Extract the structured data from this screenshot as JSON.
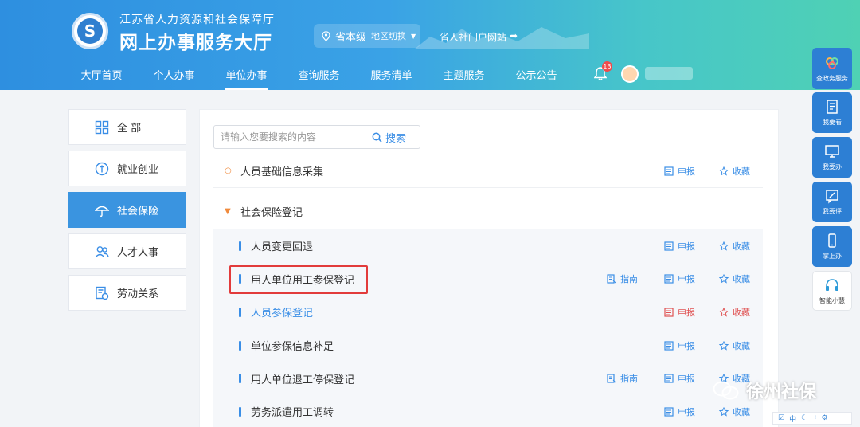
{
  "header": {
    "org_name": "江苏省人力资源和社会保障厅",
    "site_name": "网上办事服务大厅",
    "region_level": "省本级",
    "region_switch": "地区切换",
    "portal_link": "省人社门户网站",
    "notification_count": "13",
    "nav": [
      "大厅首页",
      "个人办事",
      "单位办事",
      "查询服务",
      "服务清单",
      "主题服务",
      "公示公告"
    ],
    "active_nav": "单位办事"
  },
  "sidebar": {
    "items": [
      {
        "label": "全 部",
        "icon": "grid-icon"
      },
      {
        "label": "就业创业",
        "icon": "badge-icon"
      },
      {
        "label": "社会保险",
        "icon": "umbrella-icon"
      },
      {
        "label": "人才人事",
        "icon": "people-icon"
      },
      {
        "label": "劳动关系",
        "icon": "contract-icon"
      }
    ],
    "active": "社会保险"
  },
  "search": {
    "placeholder": "请输入您要搜索的内容",
    "button_label": "搜索"
  },
  "categories": [
    {
      "label": "人员基础信息采集",
      "apply": "申报",
      "favorite": "收藏"
    },
    {
      "label": "社会保险登记"
    }
  ],
  "services": [
    {
      "title": "人员变更回退",
      "apply": "申报",
      "favorite": "收藏"
    },
    {
      "title": "用人单位用工参保登记",
      "guide": "指南",
      "apply": "申报",
      "favorite": "收藏"
    },
    {
      "title": "人员参保登记",
      "apply": "申报",
      "favorite": "收藏"
    },
    {
      "title": "单位参保信息补足",
      "apply": "申报",
      "favorite": "收藏"
    },
    {
      "title": "用人单位退工停保登记",
      "guide": "指南",
      "apply": "申报",
      "favorite": "收藏"
    },
    {
      "title": "劳务派遣用工调转",
      "apply": "申报",
      "favorite": "收藏"
    }
  ],
  "right_toolbar": [
    "查政务服务",
    "我要看",
    "我要办",
    "我要评",
    "掌上办",
    "智能小慧"
  ],
  "watermark": "徐州社保",
  "bottom_strip": "中",
  "colors": {
    "primary": "#3a8ee6",
    "active_sidebar": "#3a94e0",
    "highlight": "#e23b3b",
    "accent_orange": "#f08a3c"
  }
}
